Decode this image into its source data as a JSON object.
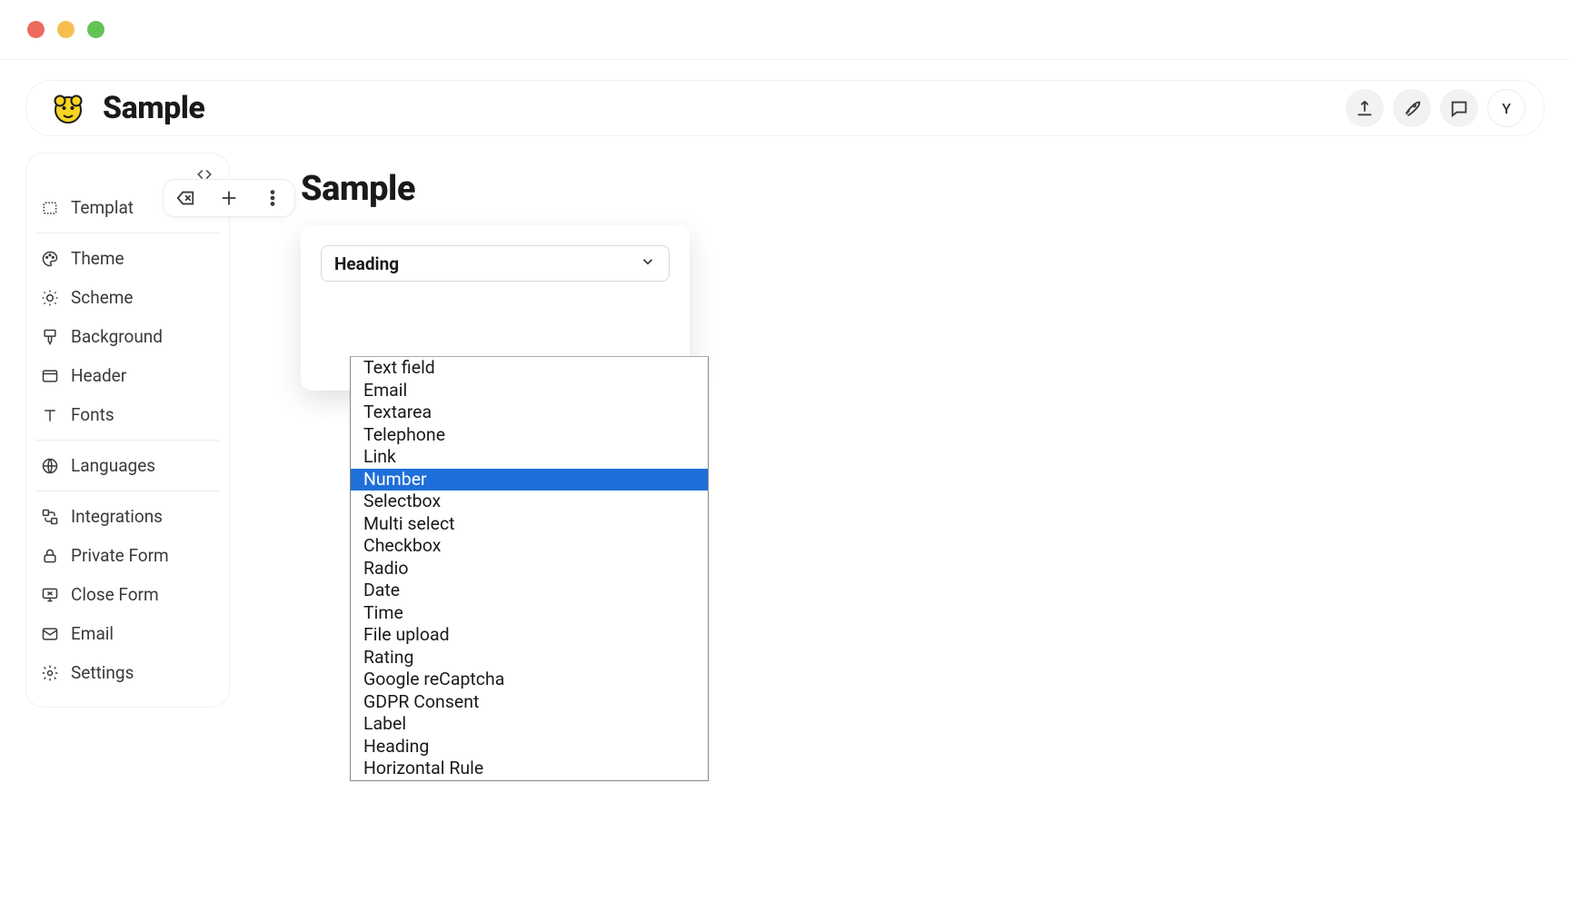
{
  "topbar": {
    "title": "Sample",
    "avatar_initial": "Y"
  },
  "sidebar": {
    "items": [
      {
        "id": "templates",
        "label": "Templat",
        "icon": "template-icon"
      },
      {
        "id": "theme",
        "label": "Theme",
        "icon": "palette-icon"
      },
      {
        "id": "scheme",
        "label": "Scheme",
        "icon": "sun-icon"
      },
      {
        "id": "background",
        "label": "Background",
        "icon": "brush-icon"
      },
      {
        "id": "header",
        "label": "Header",
        "icon": "header-icon"
      },
      {
        "id": "fonts",
        "label": "Fonts",
        "icon": "type-icon"
      },
      {
        "id": "languages",
        "label": "Languages",
        "icon": "globe-icon"
      },
      {
        "id": "integrations",
        "label": "Integrations",
        "icon": "integrations-icon"
      },
      {
        "id": "private-form",
        "label": "Private Form",
        "icon": "lock-icon"
      },
      {
        "id": "close-form",
        "label": "Close Form",
        "icon": "monitor-off-icon"
      },
      {
        "id": "email",
        "label": "Email",
        "icon": "mail-icon"
      },
      {
        "id": "settings",
        "label": "Settings",
        "icon": "gear-icon"
      }
    ]
  },
  "main": {
    "title": "Sample",
    "select": {
      "current": "Heading",
      "options": [
        "Text field",
        "Email",
        "Textarea",
        "Telephone",
        "Link",
        "Number",
        "Selectbox",
        "Multi select",
        "Checkbox",
        "Radio",
        "Date",
        "Time",
        "File upload",
        "Rating",
        "Google reCaptcha",
        "GDPR Consent",
        "Label",
        "Heading",
        "Horizontal Rule"
      ],
      "highlighted_index": 5
    }
  }
}
